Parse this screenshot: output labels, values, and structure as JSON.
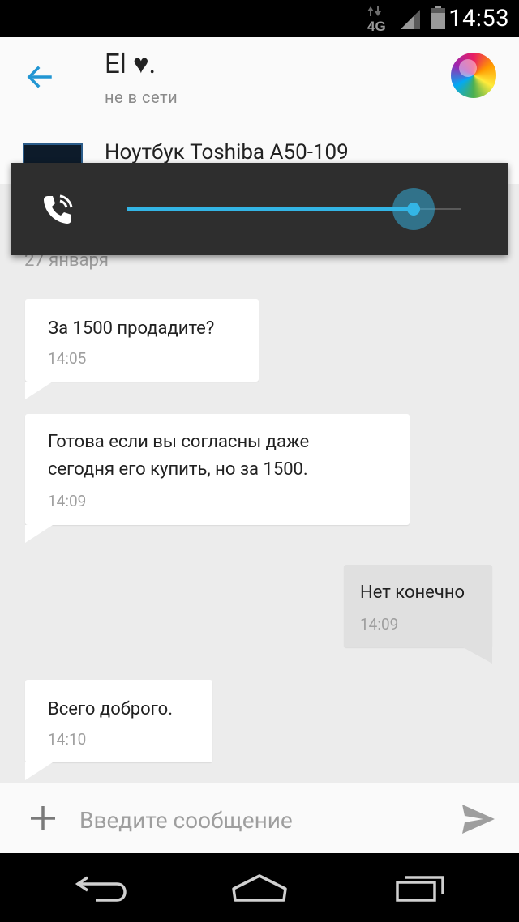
{
  "status_bar": {
    "network": "4G",
    "time": "14:53",
    "icons": [
      "data-arrows-icon",
      "signal-icon",
      "battery-icon"
    ]
  },
  "header": {
    "title": "El ♥.",
    "status": "не в сети",
    "back_icon": "arrow-left-icon",
    "avatar": "avatar-balloons"
  },
  "product": {
    "title": "Ноутбук Toshiba A50-109"
  },
  "volume_overlay": {
    "icon": "phone-in-call-icon",
    "level": 0.86,
    "accent_color": "#33b5e5"
  },
  "messages": {
    "date_separator": "27 января",
    "items": [
      {
        "direction": "incoming",
        "lines": [
          "За 1500 продадите?"
        ],
        "time": "14:05"
      },
      {
        "direction": "incoming",
        "lines": [
          "Готова если вы согласны даже",
          "сегодня его купить, но за 1500."
        ],
        "time": "14:09"
      },
      {
        "direction": "outgoing",
        "lines": [
          "Нет конечно"
        ],
        "time": "14:09"
      },
      {
        "direction": "incoming",
        "lines": [
          "Всего доброго."
        ],
        "time": "14:10"
      }
    ]
  },
  "input": {
    "placeholder": "Введите сообщение",
    "value": "",
    "attach_icon": "plus-icon",
    "send_icon": "send-icon"
  },
  "nav_bar": {
    "buttons": [
      "back-icon",
      "home-icon",
      "recent-apps-icon"
    ]
  }
}
